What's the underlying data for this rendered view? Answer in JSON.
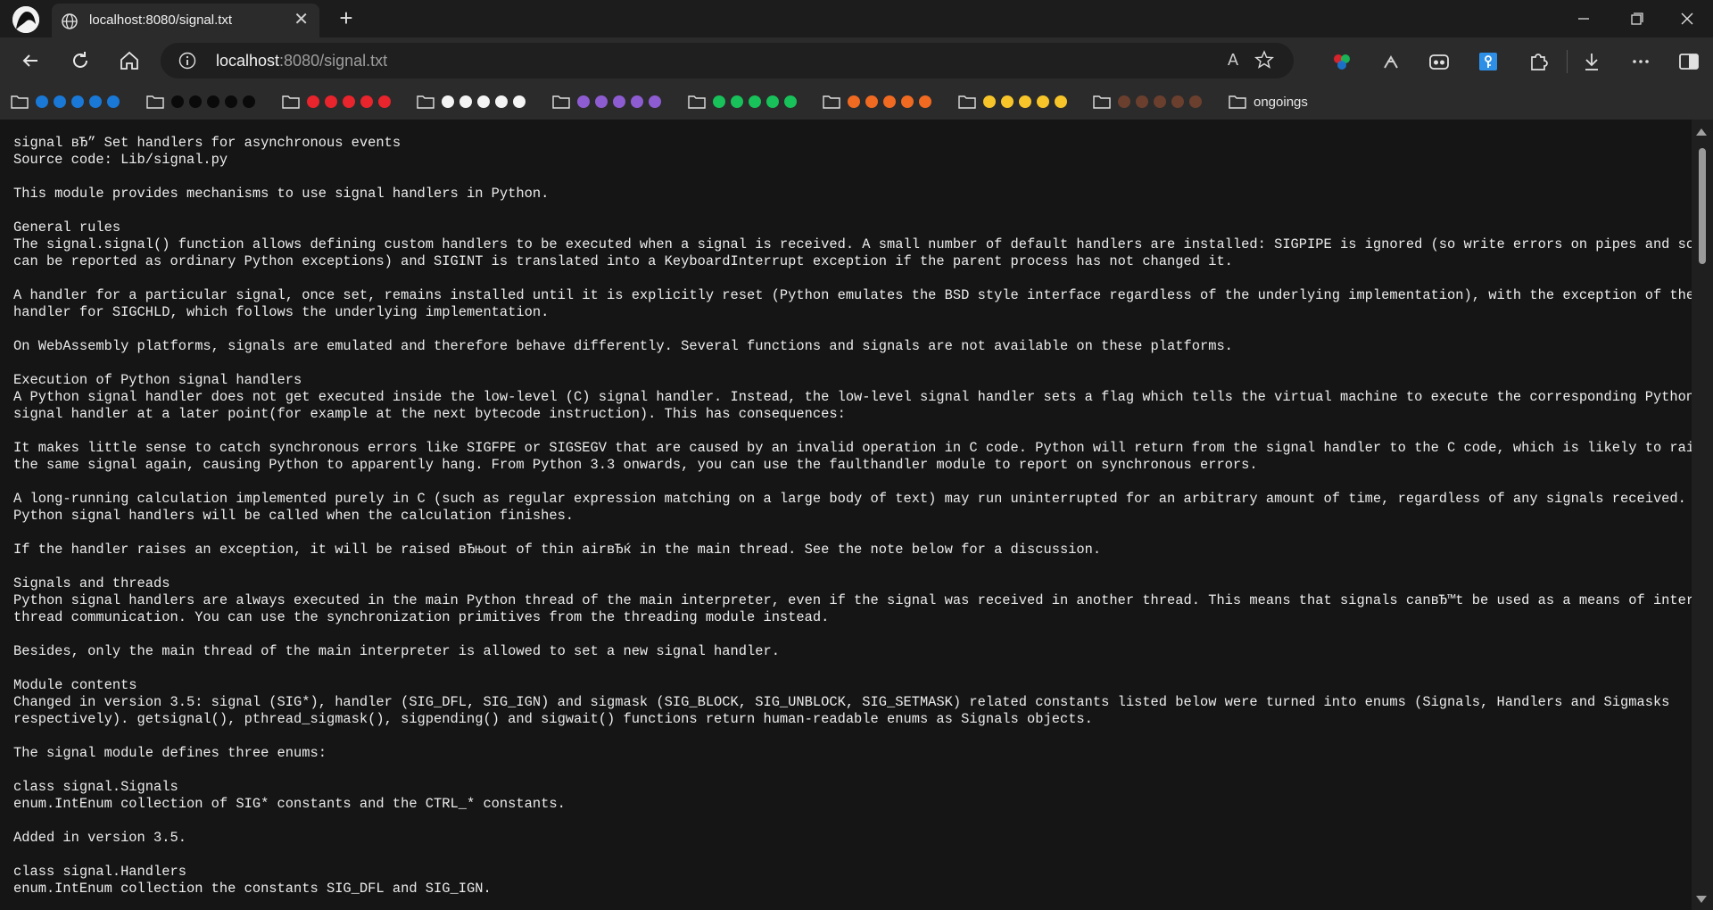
{
  "tab": {
    "title": "localhost:8080/signal.txt",
    "close_glyph": "✕",
    "new_tab_glyph": "+"
  },
  "address_bar": {
    "host": "localhost",
    "rest": ":8080/signal.txt",
    "read_aloud": "A"
  },
  "bookmark_groups": [
    {
      "color": "#1a78d6",
      "dots": 5
    },
    {
      "color": "#0a0a0a",
      "dots": 5
    },
    {
      "color": "#e8242c",
      "dots": 5
    },
    {
      "color": "#f4f4f4",
      "dots": 5
    },
    {
      "color": "#8e5cd1",
      "dots": 5
    },
    {
      "color": "#18c15a",
      "dots": 5
    },
    {
      "color": "#f06a22",
      "dots": 5
    },
    {
      "color": "#f7c52a",
      "dots": 5
    },
    {
      "color": "#6b3f2e",
      "dots": 5
    }
  ],
  "bookmarks": {
    "ongoings_label": "ongoings"
  },
  "icons": {
    "profile": "profile-avatar-icon",
    "tab": "globe-icon",
    "back": "back-arrow-icon",
    "refresh": "refresh-icon",
    "home": "home-icon",
    "info": "info-icon",
    "favorite": "star-icon",
    "extension1": "color-wheel-extension-icon",
    "extension2": "tools-extension-icon",
    "extension3": "gamepad-extension-icon",
    "extension4": "key-extension-icon",
    "extensions": "puzzle-icon",
    "downloads": "download-icon",
    "more": "more-icon",
    "split": "split-screen-icon",
    "folder": "folder-icon"
  },
  "document": {
    "lines": [
      "signal вЂ” Set handlers for asynchronous events",
      "Source code: Lib/signal.py",
      "",
      "This module provides mechanisms to use signal handlers in Python.",
      "",
      "General rules",
      "The signal.signal() function allows defining custom handlers to be executed when a signal is received. A small number of default handlers are installed: SIGPIPE is ignored (so write errors on pipes and sockets",
      "can be reported as ordinary Python exceptions) and SIGINT is translated into a KeyboardInterrupt exception if the parent process has not changed it.",
      "",
      "A handler for a particular signal, once set, remains installed until it is explicitly reset (Python emulates the BSD style interface regardless of the underlying implementation), with the exception of the",
      "handler for SIGCHLD, which follows the underlying implementation.",
      "",
      "On WebAssembly platforms, signals are emulated and therefore behave differently. Several functions and signals are not available on these platforms.",
      "",
      "Execution of Python signal handlers",
      "A Python signal handler does not get executed inside the low-level (C) signal handler. Instead, the low-level signal handler sets a flag which tells the virtual machine to execute the corresponding Python",
      "signal handler at a later point(for example at the next bytecode instruction). This has consequences:",
      "",
      "It makes little sense to catch synchronous errors like SIGFPE or SIGSEGV that are caused by an invalid operation in C code. Python will return from the signal handler to the C code, which is likely to raise",
      "the same signal again, causing Python to apparently hang. From Python 3.3 onwards, you can use the faulthandler module to report on synchronous errors.",
      "",
      "A long-running calculation implemented purely in C (such as regular expression matching on a large body of text) may run uninterrupted for an arbitrary amount of time, regardless of any signals received. The",
      "Python signal handlers will be called when the calculation finishes.",
      "",
      "If the handler raises an exception, it will be raised вЂњout of thin airвЂќ in the main thread. See the note below for a discussion.",
      "",
      "Signals and threads",
      "Python signal handlers are always executed in the main Python thread of the main interpreter, even if the signal was received in another thread. This means that signals canвЂ™t be used as a means of inter-",
      "thread communication. You can use the synchronization primitives from the threading module instead.",
      "",
      "Besides, only the main thread of the main interpreter is allowed to set a new signal handler.",
      "",
      "Module contents",
      "Changed in version 3.5: signal (SIG*), handler (SIG_DFL, SIG_IGN) and sigmask (SIG_BLOCK, SIG_UNBLOCK, SIG_SETMASK) related constants listed below were turned into enums (Signals, Handlers and Sigmasks",
      "respectively). getsignal(), pthread_sigmask(), sigpending() and sigwait() functions return human-readable enums as Signals objects.",
      "",
      "The signal module defines three enums:",
      "",
      "class signal.Signals",
      "enum.IntEnum collection of SIG* constants and the CTRL_* constants.",
      "",
      "Added in version 3.5.",
      "",
      "class signal.Handlers",
      "enum.IntEnum collection the constants SIG_DFL and SIG_IGN."
    ]
  }
}
